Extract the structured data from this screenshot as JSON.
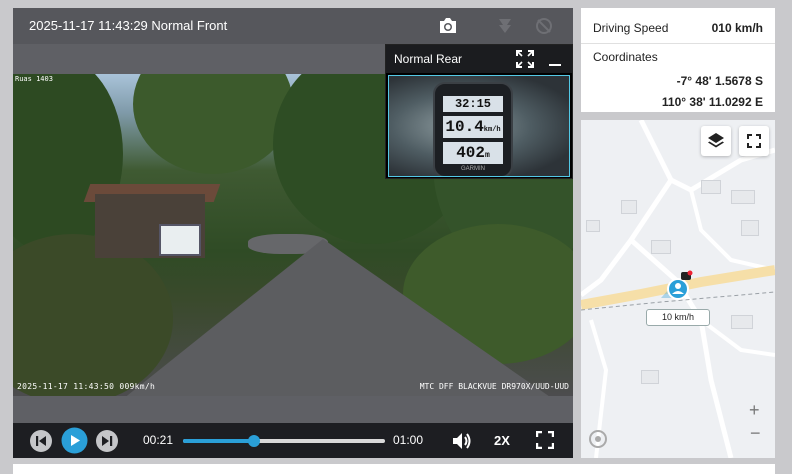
{
  "player": {
    "title": "2025-11-17 11:43:29 Normal Front",
    "front_overlay_tl": "Ruas 1403",
    "front_stamp_left": "2025-11-17 11:43:50 009km/h",
    "front_stamp_right": "MTC DFF BLACKVUE DR970X/UUD-UUD",
    "rear": {
      "title": "Normal Rear",
      "gps_time": "32:15",
      "gps_speed": "10.4",
      "gps_speed_unit": "km/h",
      "gps_distance": "402",
      "gps_distance_unit": "m",
      "gps_brand": "GARMIN"
    },
    "controls": {
      "time_current": "00:21",
      "time_total": "01:00",
      "progress": 0.35,
      "speed_rate": "2X"
    }
  },
  "info": {
    "speed_label": "Driving Speed",
    "speed_value": "010 km/h",
    "coord_label": "Coordinates",
    "latitude": "-7° 48' 1.5678 S",
    "longitude": "110° 38' 11.0292 E"
  },
  "map": {
    "speed_tag": "10 km/h",
    "zoom_in": "+",
    "zoom_out": "−",
    "road_color": "#f6dfa8",
    "marker_color": "#2a9fd8"
  },
  "icons": [
    "camera-icon",
    "save-icon",
    "no-record-icon",
    "expand-icon",
    "minimize-icon",
    "prev-icon",
    "play-icon",
    "next-icon",
    "volume-icon",
    "fullscreen-icon",
    "layers-icon",
    "map-fullscreen-icon",
    "user-marker-icon",
    "compass-icon"
  ]
}
